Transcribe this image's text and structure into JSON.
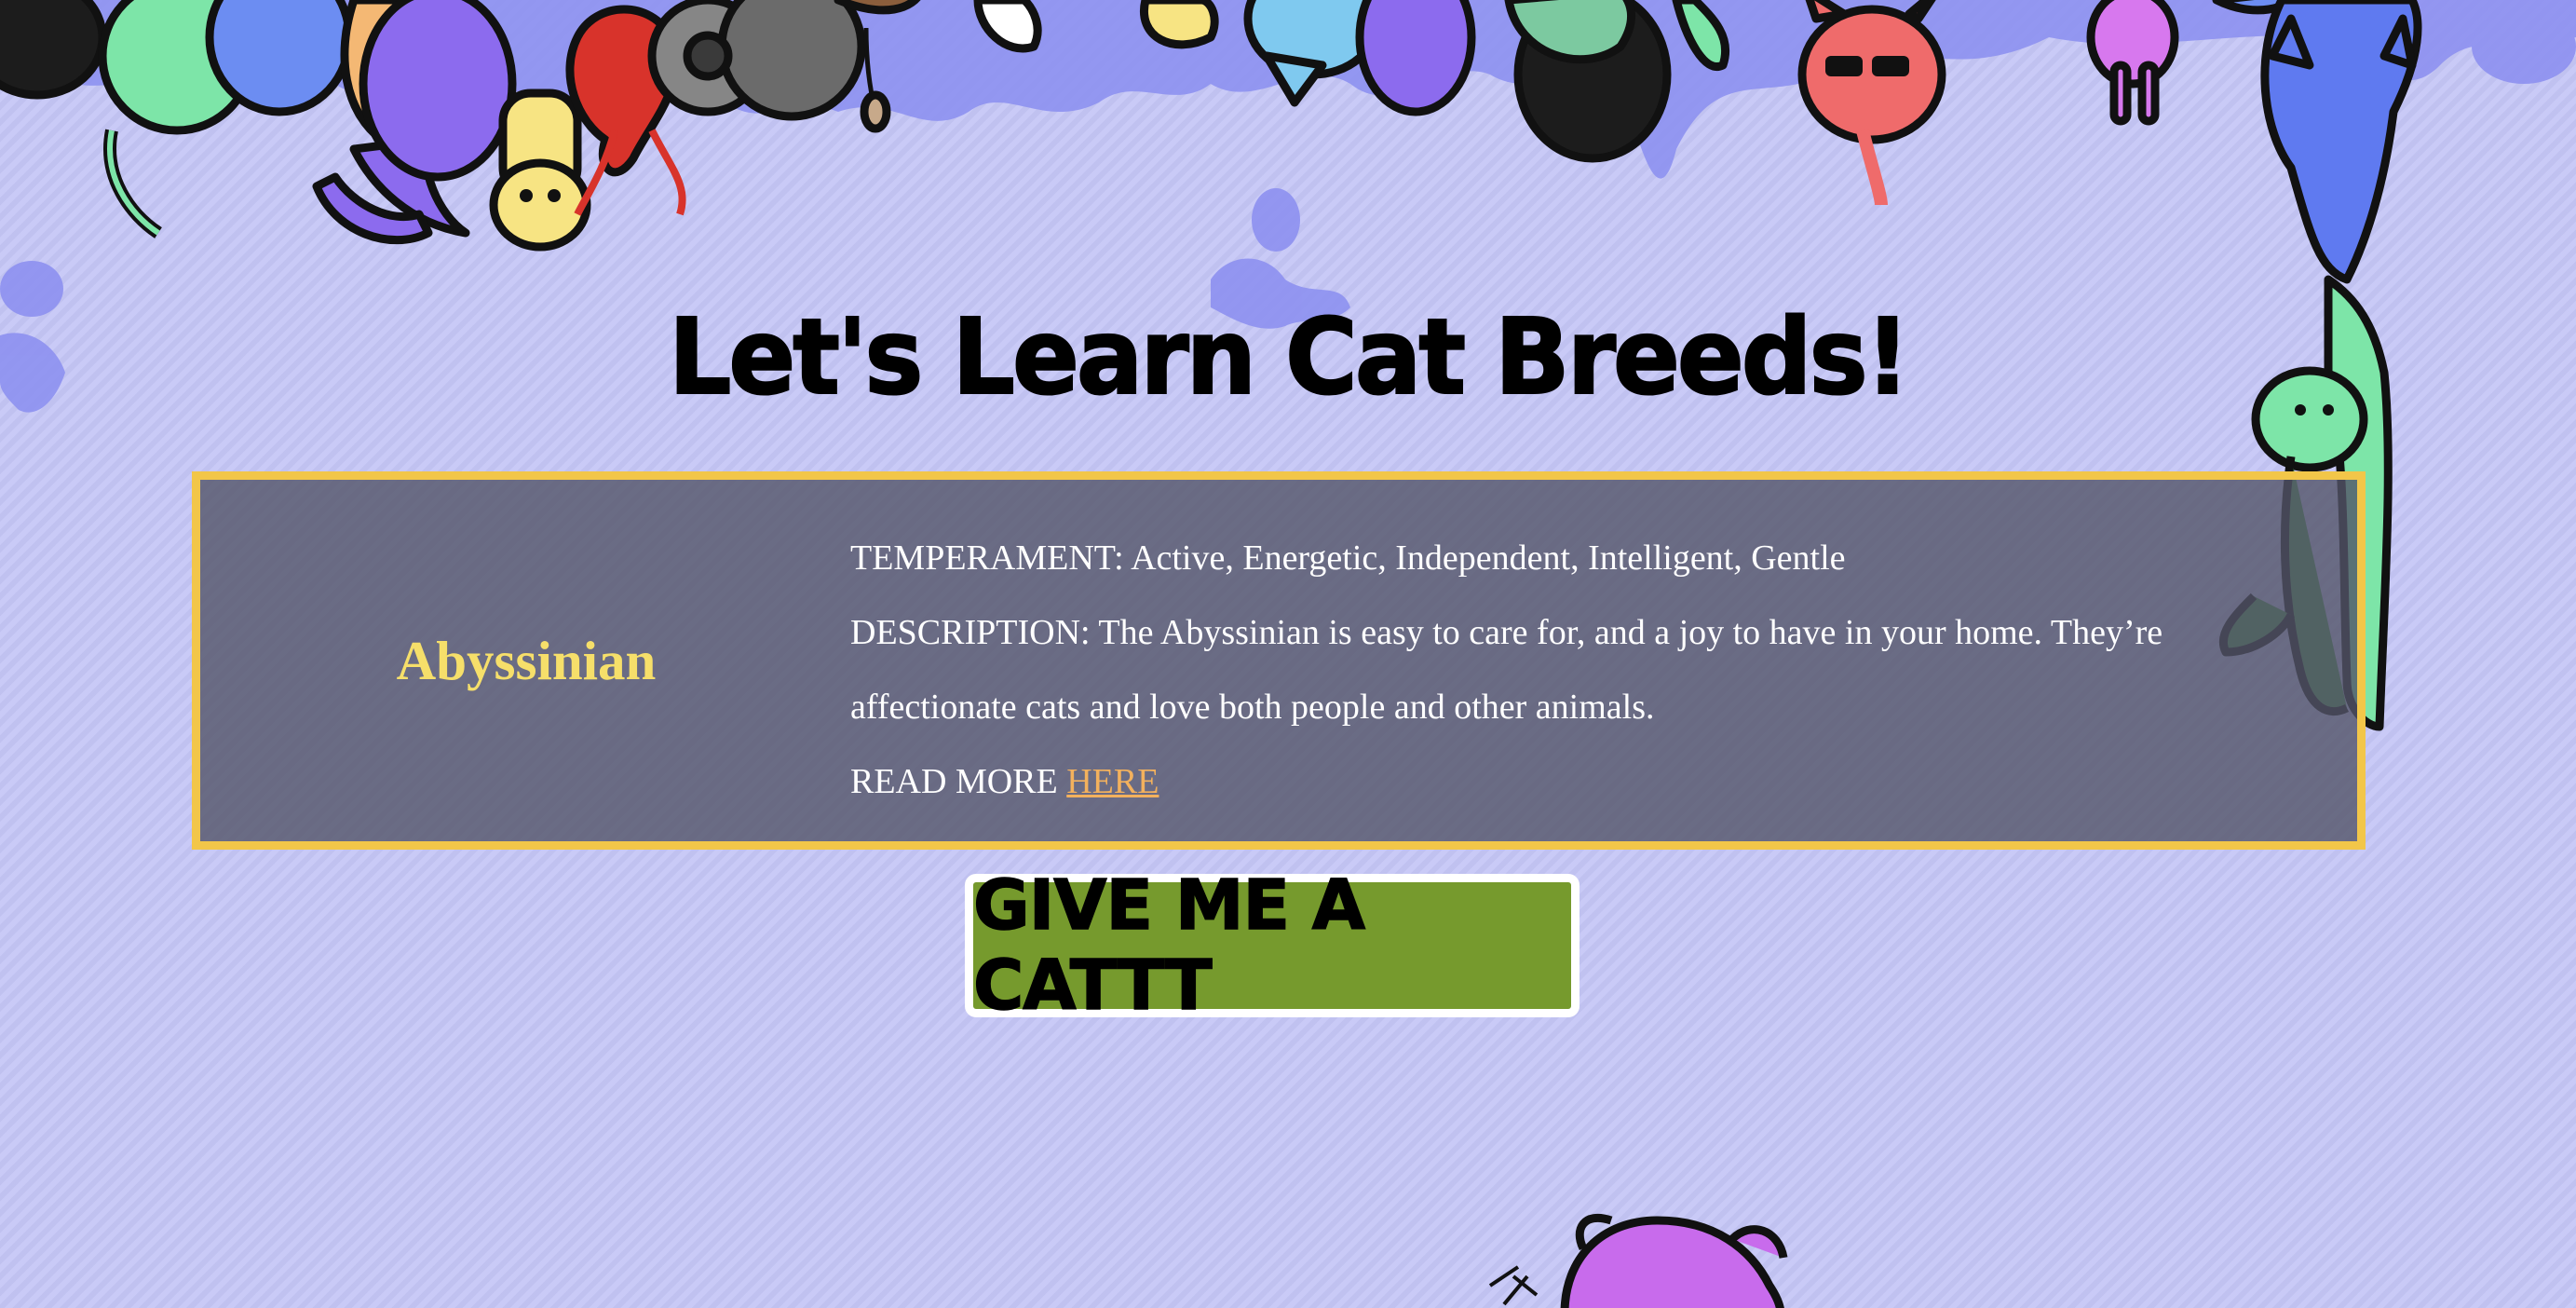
{
  "page": {
    "title": "Let's Learn Cat Breeds!"
  },
  "breed": {
    "name": "Abyssinian",
    "temperament": "TEMPERAMENT: Active, Energetic, Independent, Intelligent, Gentle",
    "description": "DESCRIPTION: The Abyssinian is easy to care for, and a joy to have in your home. They’re affectionate cats and love both people and other animals.",
    "read_more_label": "READ MORE ",
    "read_more_link": "HERE"
  },
  "action": {
    "button_label": "GIVE ME A CATTT"
  },
  "colors": {
    "background": "#c5c6f6",
    "card_border": "#f2c649",
    "breed_name": "#f6df6a",
    "link": "#f3b15d",
    "button": "#769a2d"
  },
  "decor": {
    "top_banner": "hanging-cartoon-cats-illustration",
    "bottom_peek": "purple-cartoon-cat-head"
  }
}
